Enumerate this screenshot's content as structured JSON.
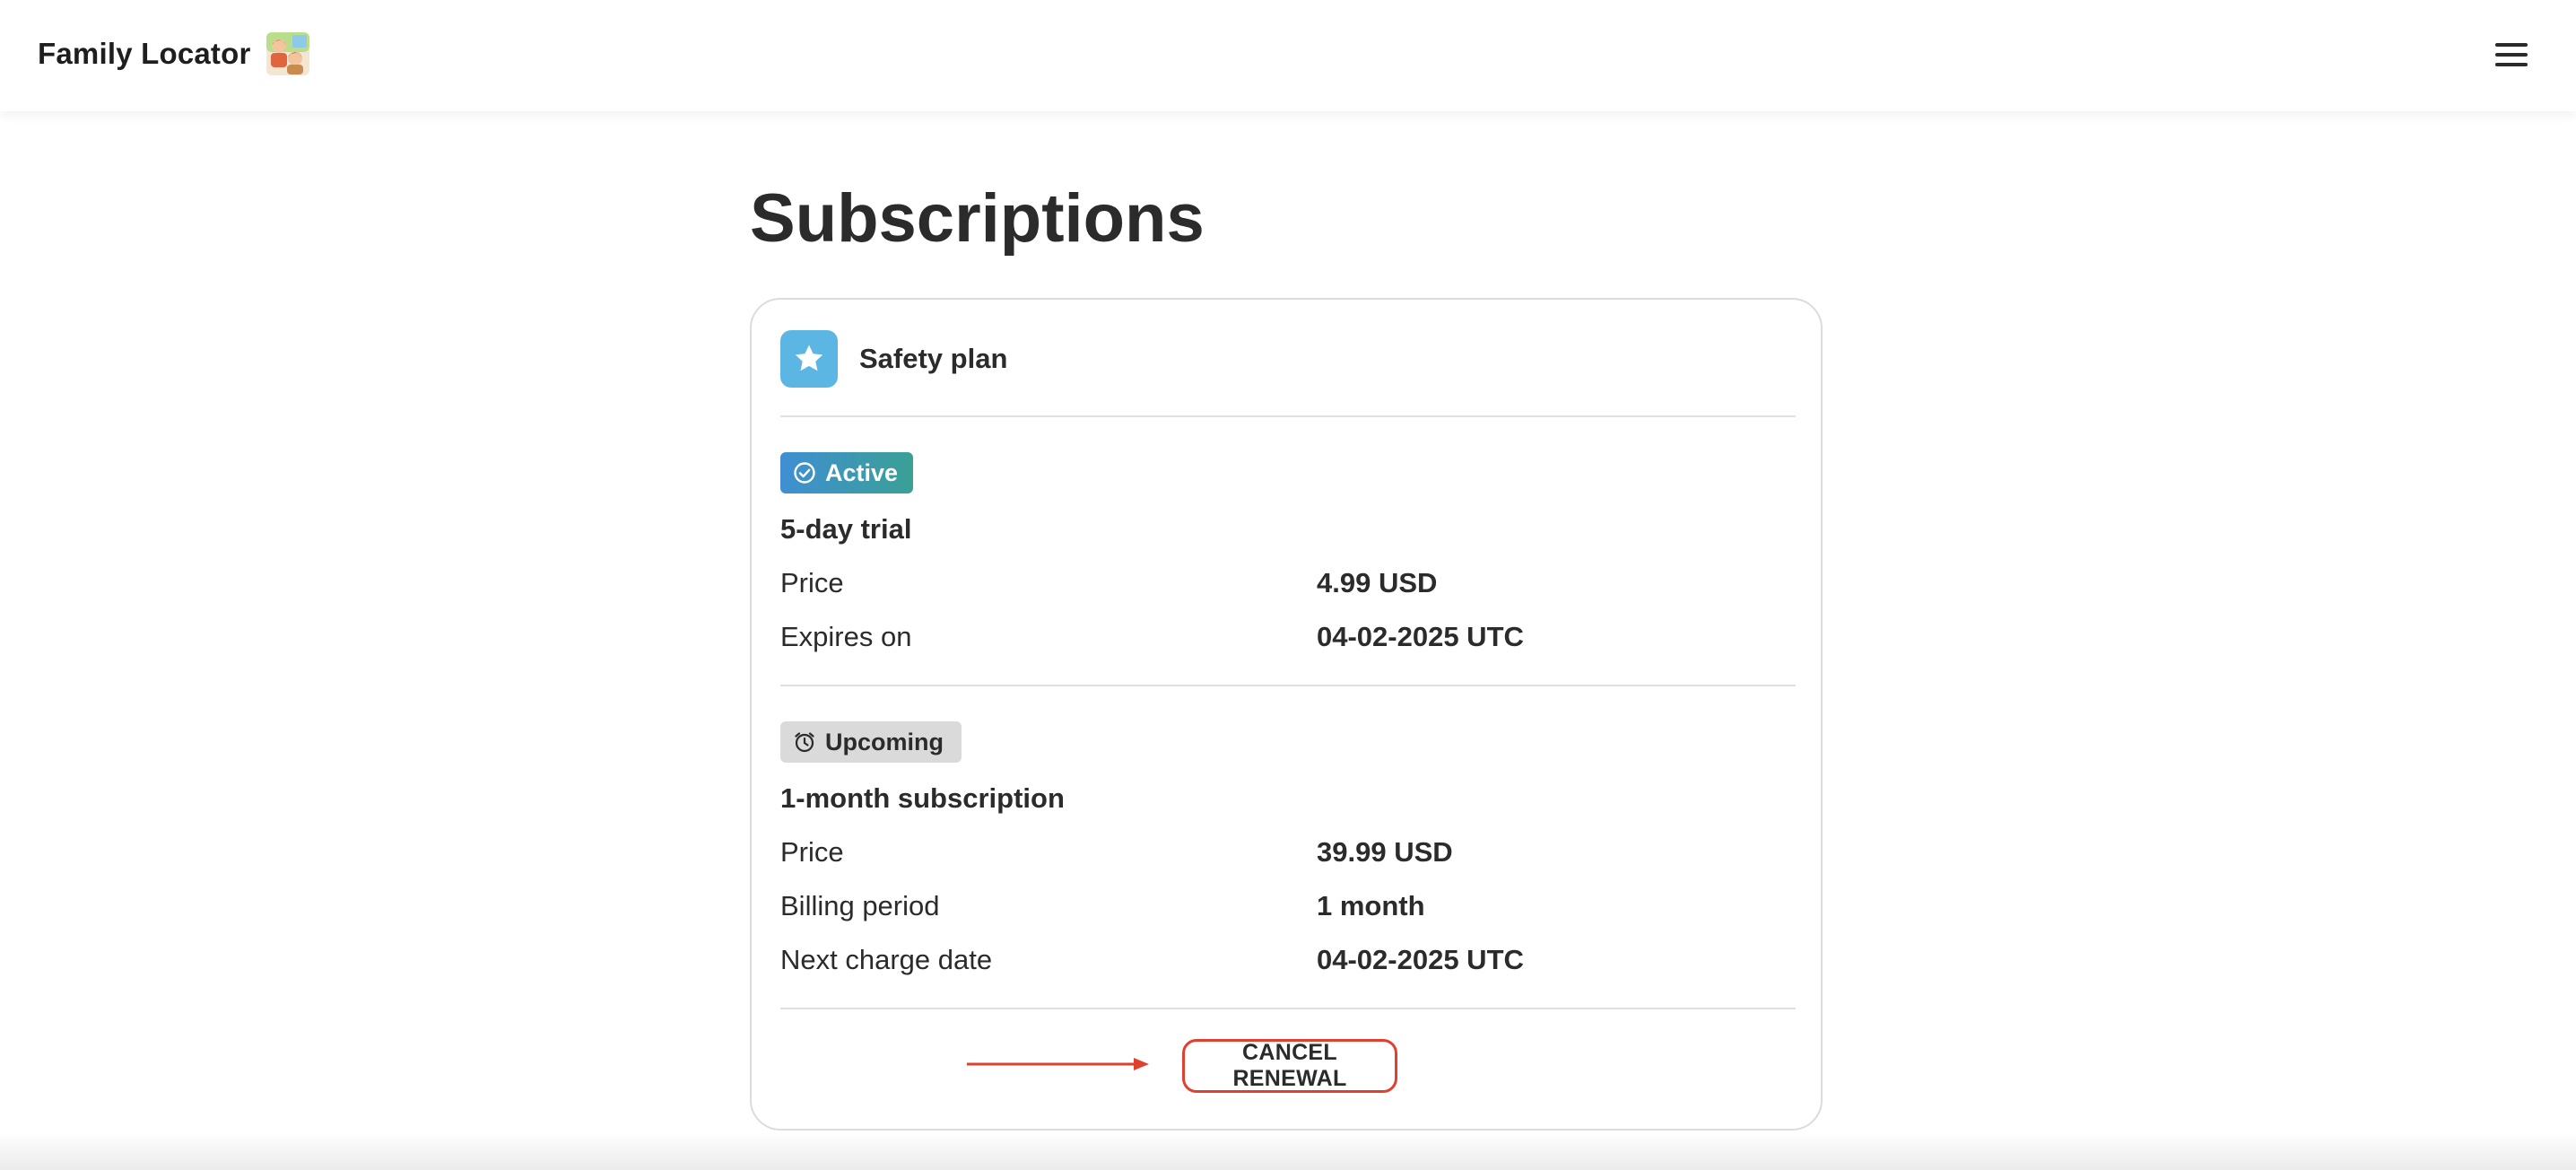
{
  "app": {
    "name": "Family Locator",
    "logo_icon": "family-photo-icon",
    "menu_icon": "hamburger-menu-icon"
  },
  "page": {
    "title": "Subscriptions"
  },
  "plan": {
    "icon": "star-icon",
    "icon_color": "#5bb6e4",
    "name": "Safety plan"
  },
  "active": {
    "badge_icon": "check-circle-icon",
    "badge_label": "Active",
    "title": "5-day trial",
    "rows": [
      {
        "label": "Price",
        "value": "4.99 USD"
      },
      {
        "label": "Expires on",
        "value": "04-02-2025 UTC"
      }
    ]
  },
  "upcoming": {
    "badge_icon": "alarm-clock-icon",
    "badge_label": "Upcoming",
    "title": "1-month subscription",
    "rows": [
      {
        "label": "Price",
        "value": "39.99 USD"
      },
      {
        "label": "Billing period",
        "value": "1 month"
      },
      {
        "label": "Next charge date",
        "value": "04-02-2025 UTC"
      }
    ]
  },
  "actions": {
    "cancel_label": "CANCEL RENEWAL",
    "highlight_color": "#e0412f"
  }
}
